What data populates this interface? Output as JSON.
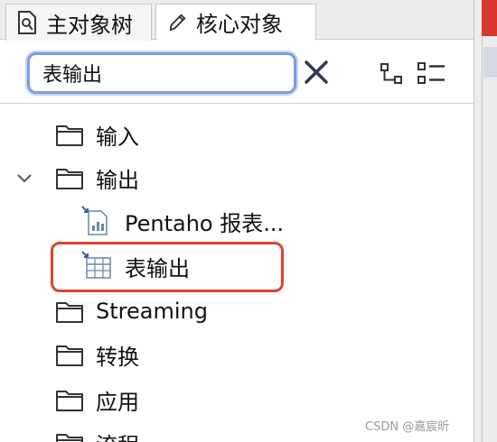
{
  "tabs": [
    {
      "label": "主对象树",
      "icon": "tree-search-icon"
    },
    {
      "label": "核心对象",
      "icon": "pencil-icon"
    }
  ],
  "search": {
    "value": "表输出",
    "clear_icon": "close-icon"
  },
  "toolbar": {
    "collapse_icon": "tree-structure-icon",
    "expand_icon": "list-view-icon"
  },
  "tree": {
    "items": [
      {
        "label": "输入",
        "icon": "folder-icon",
        "expanded": false
      },
      {
        "label": "输出",
        "icon": "folder-icon",
        "expanded": true
      },
      {
        "label": "Pentaho 报表...",
        "icon": "report-output-icon",
        "child": true
      },
      {
        "label": "表输出",
        "icon": "table-output-icon",
        "child": true,
        "highlighted": true
      },
      {
        "label": "Streaming",
        "icon": "folder-icon"
      },
      {
        "label": "转换",
        "icon": "folder-icon"
      },
      {
        "label": "应用",
        "icon": "folder-icon"
      },
      {
        "label": "流程",
        "icon": "folder-icon"
      }
    ]
  },
  "colors": {
    "highlight": "#e0432e",
    "focus": "#7d9be3"
  },
  "watermark": "CSDN @嘉宸昕"
}
